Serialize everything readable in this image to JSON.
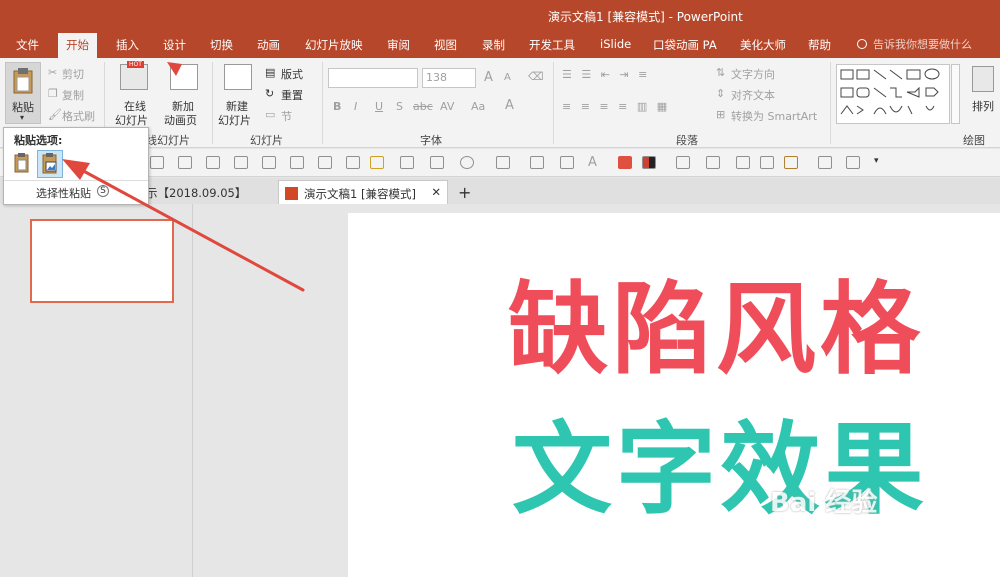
{
  "window": {
    "title": "演示文稿1 [兼容模式] - PowerPoint"
  },
  "ribbon_tabs": [
    {
      "label": "文件"
    },
    {
      "label": "开始"
    },
    {
      "label": "插入"
    },
    {
      "label": "设计"
    },
    {
      "label": "切换"
    },
    {
      "label": "动画"
    },
    {
      "label": "幻灯片放映"
    },
    {
      "label": "审阅"
    },
    {
      "label": "视图"
    },
    {
      "label": "录制"
    },
    {
      "label": "开发工具"
    },
    {
      "label": "iSlide"
    },
    {
      "label": "口袋动画 PA"
    },
    {
      "label": "美化大师"
    },
    {
      "label": "帮助"
    }
  ],
  "search": {
    "placeholder": "告诉我你想要做什么"
  },
  "clipboard": {
    "paste": "粘贴",
    "cut": "剪切",
    "copy": "复制",
    "format_painter": "格式刷"
  },
  "slides_group": {
    "online_slides": "在线",
    "online_slides_2": "幻灯片",
    "new_anim_page": "新加",
    "new_anim_page_2": "动画页",
    "new_slide": "新建",
    "new_slide_2": "幻灯片",
    "layout": "版式",
    "reset": "重置",
    "section": "节",
    "group_label_online": "线幻灯片",
    "group_label": "幻灯片",
    "hot_badge": "HOT"
  },
  "font_group": {
    "size": "138",
    "label": "字体",
    "bold": "B",
    "italic": "I",
    "underline": "U",
    "strike": "S",
    "abc": "abc",
    "av": "AV",
    "aa": "Aa",
    "grow": "A",
    "shrink": "A",
    "color_a": "A"
  },
  "paragraph_group": {
    "label": "段落",
    "text_direction": "文字方向",
    "align_text": "对齐文本",
    "smartart": "转换为 SmartArt"
  },
  "drawing_group": {
    "label": "绘图",
    "arrange": "排列"
  },
  "paste_popup": {
    "title": "粘贴选项:",
    "special": "选择性粘贴",
    "shortcut": "S"
  },
  "doc_tabs": [
    {
      "label": "示【2018.09.05】"
    },
    {
      "label": "演示文稿1 [兼容模式]"
    }
  ],
  "new_tab": "+",
  "slide_content": {
    "line1": "缺陷风格",
    "line2": "文字效果"
  },
  "watermark": "Bai 经验",
  "colors": {
    "accent": "#b7472a",
    "red_text": "#f04d5a",
    "teal_text": "#2ec6b0",
    "arrow": "#e0483d"
  }
}
